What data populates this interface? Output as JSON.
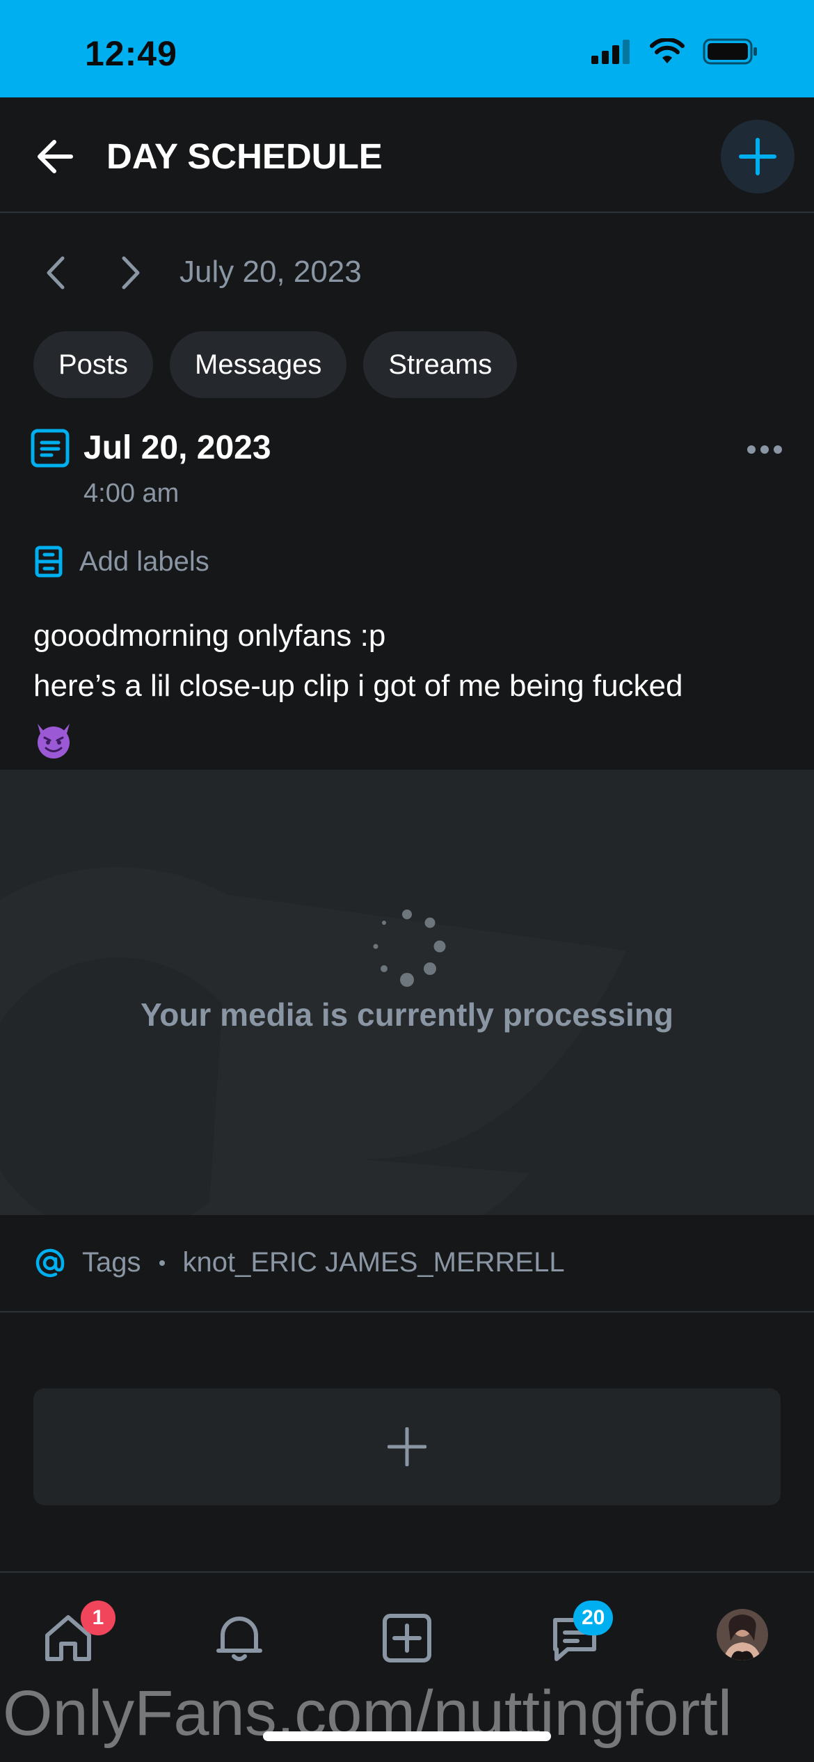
{
  "status_bar": {
    "time": "12:49",
    "icons": [
      "signal-icon",
      "wifi-icon",
      "battery-icon"
    ]
  },
  "header": {
    "title": "DAY SCHEDULE",
    "back_icon": "back-arrow-icon",
    "add_icon": "plus-icon"
  },
  "date_nav": {
    "date": "July 20, 2023"
  },
  "filters": [
    {
      "label": "Posts"
    },
    {
      "label": "Messages"
    },
    {
      "label": "Streams"
    }
  ],
  "post": {
    "date": "Jul 20, 2023",
    "time": "4:00 am",
    "add_labels": "Add labels",
    "text_lines": [
      "gooodmorning onlyfans :p",
      "here’s a lil close-up clip i got of me being fucked"
    ],
    "emoji": "smiling-devil-emoji",
    "media_status": "Your media is currently processing",
    "tags_label": "Tags",
    "tags_value": "knot_ERIC JAMES_MERRELL"
  },
  "bottom_nav": {
    "home_badge": "1",
    "messages_badge": "20"
  },
  "watermark": "OnlyFans.com/nuttingfortl",
  "colors": {
    "accent": "#00aff0",
    "background": "#161719",
    "muted_text": "#8a96a3",
    "badge_red": "#f0455a"
  }
}
